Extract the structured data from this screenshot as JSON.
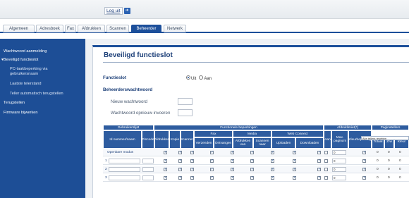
{
  "header": {
    "logout_label": "Log uit",
    "logout_icon": "arrow-right-icon"
  },
  "tabs": [
    {
      "label": "Algemeen"
    },
    {
      "label": "Adresboek"
    },
    {
      "label": "Fax"
    },
    {
      "label": "Afdrukken"
    },
    {
      "label": "Scannen"
    },
    {
      "label": "Beheerder",
      "active": true
    },
    {
      "label": "Netwerk"
    }
  ],
  "sidebar": {
    "items": [
      {
        "label": "Wachtwoord aanmelding"
      },
      {
        "label": "Beveiligd functieslot"
      },
      {
        "label": "PC-taakbeperking via"
      },
      {
        "label": "gebruikersnaam"
      },
      {
        "label": "Laatste telerstand"
      },
      {
        "label": "Teller automatisch terugstellen"
      },
      {
        "label": "Terugstellen"
      },
      {
        "label": "Firmware bijwerken"
      }
    ]
  },
  "page": {
    "title": "Beveiligd functieslot",
    "functieslot_label": "Functieslot",
    "radio_uit": "Uit",
    "radio_aan": "Aan",
    "admin_password_heading": "Beheerderswachtwoord",
    "new_password_label": "Nieuw wachtwoord",
    "retype_password_label": "Wachtwoord opnieuw invoeren"
  },
  "table": {
    "headers": {
      "gebruikerslijst": "Gebruikerslijst",
      "functies": "Functionele beperkingen",
      "afdruklimiet": "Afdruklimiet(*)",
      "paginatellers": "Paginatellers",
      "fax": "Fax",
      "media": "Media",
      "web_connect": "Web Connect",
      "id": "Id nummer/naam",
      "pincode": "Pincode",
      "afdrukken": "Afdrukken",
      "kopie": "Kopie",
      "scannen": "Scannen",
      "verzenden": "Verzenden",
      "ontvangen": "Ontvangen",
      "afdrukken_van": "Afdrukken van",
      "scannen_naar": "Scannen naar",
      "uploaden": "Uploaden",
      "downloaden": "Downloaden",
      "aan": "Aan",
      "max_pagina": "Max. pagina's",
      "kleurbeperking": "Kleurbeperking",
      "totaal": "Totaal",
      "zw": "Z/w",
      "kleur": "Kleur",
      "reset_select": "Alle tellers resetten"
    },
    "public_mode": "Openbare modus",
    "rows": [
      "1",
      "2",
      "3"
    ],
    "page_value": "0",
    "counter_value": "0"
  }
}
